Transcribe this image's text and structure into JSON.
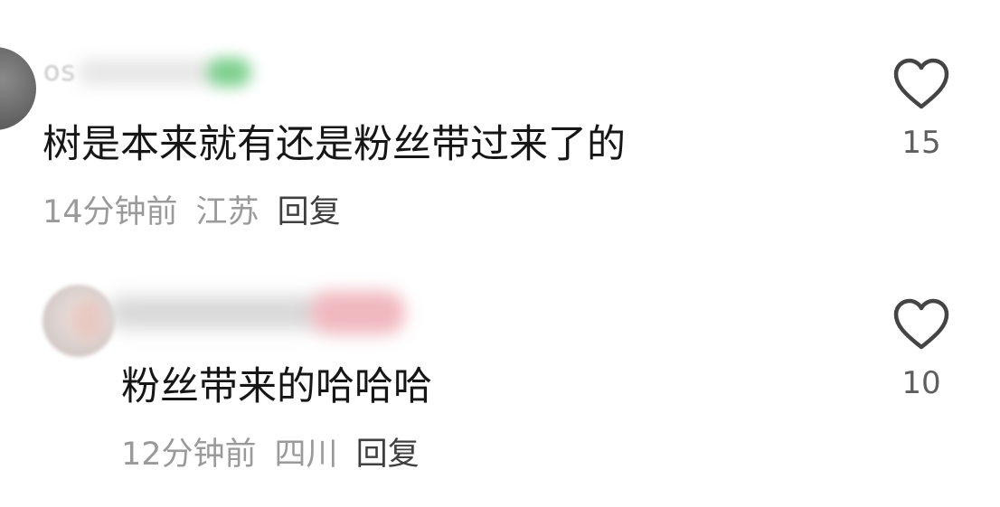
{
  "comments": [
    {
      "username_visible": "os",
      "text": "树是本来就有还是粉丝带过来了的",
      "time": "14分钟前",
      "location": "江苏",
      "reply_label": "回复",
      "like_count": "15"
    },
    {
      "username_visible": "",
      "text": "粉丝带来的哈哈哈",
      "time": "12分钟前",
      "location": "四川",
      "reply_label": "回复",
      "like_count": "10"
    }
  ],
  "icons": {
    "like": "heart-outline-icon"
  },
  "colors": {
    "text": "#161616",
    "meta": "#9a9a9a",
    "reply": "#3f3f3f",
    "like_count": "#5e5e5e",
    "heart_stroke": "#444444"
  }
}
